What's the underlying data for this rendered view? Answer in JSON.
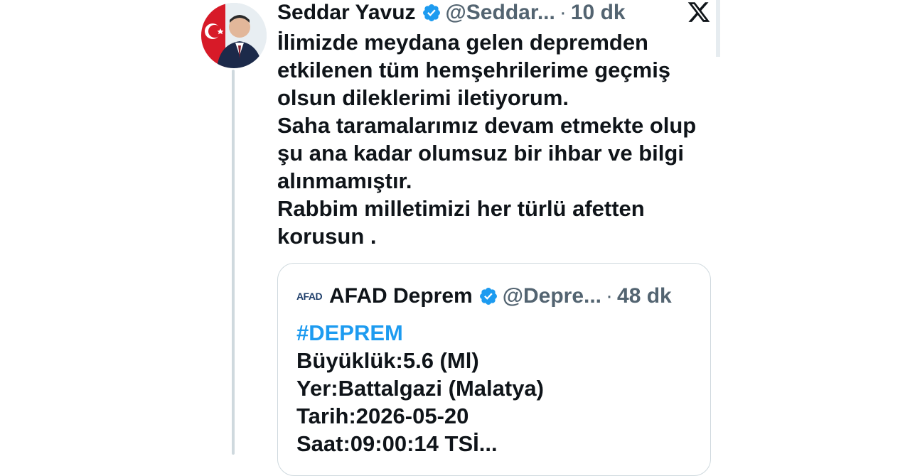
{
  "tweet": {
    "author_name": "Seddar Yavuz",
    "handle": "@Seddar...",
    "separator": "·",
    "time": "10 dk",
    "lines": [
      "İlimizde meydana gelen depremden",
      "etkilenen tüm hemşehrilerime geçmiş",
      "olsun dileklerimi iletiyorum.",
      "Saha taramalarımız devam etmekte olup",
      "şu ana kadar olumsuz bir ihbar ve bilgi",
      "alınmamıştır.",
      "Rabbim milletimizi her türlü afetten",
      "korusun ."
    ]
  },
  "quote": {
    "logo_text": "AFAD",
    "author_name": "AFAD Deprem",
    "handle": "@Depre...",
    "separator": "·",
    "time": "48 dk",
    "hashtag": "#DEPREM",
    "lines": [
      "Büyüklük:5.6 (Ml)",
      "Yer:Battalgazi (Malatya)",
      "Tarih:2026-05-20",
      "Saat:09:00:14 TSİ..."
    ]
  },
  "icons": {
    "verified": "verified-badge-icon",
    "platform": "x-logo-icon"
  },
  "colors": {
    "text": "#0f1419",
    "muted": "#536471",
    "accent": "#1d9bf0",
    "border": "#cfd9de"
  }
}
